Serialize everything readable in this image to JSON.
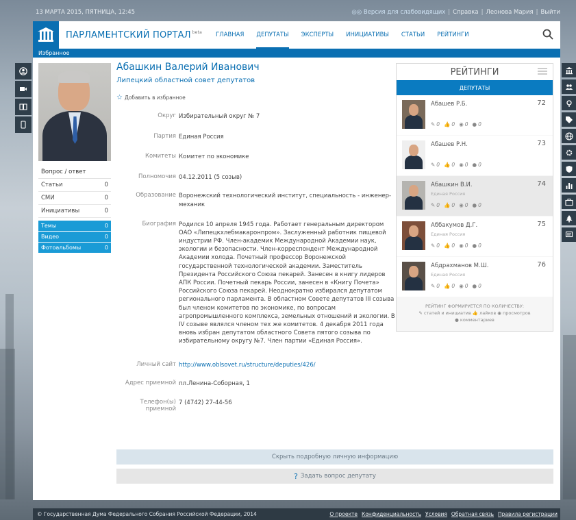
{
  "topbar": {
    "date": "13 МАРТА 2015, ПЯТНИЦА, 12:45",
    "accessible": "Версия для слабовидящих",
    "help": "Справка",
    "user": "Леонова Мария",
    "logout": "Выйти"
  },
  "header": {
    "title": "ПАРЛАМЕНТСКИЙ ПОРТАЛ",
    "beta": "beta",
    "nav": [
      "ГЛАВНАЯ",
      "ДЕПУТАТЫ",
      "ЭКСПЕРТЫ",
      "ИНИЦИАТИВЫ",
      "СТАТЬИ",
      "РЕЙТИНГИ"
    ],
    "active_nav": "ДЕПУТАТЫ"
  },
  "favorites_strip": "Избранное",
  "profile": {
    "name": "Абашкин Валерий Иванович",
    "org": "Липецкий областной совет депутатов",
    "add_fav": "Добавить в избранное",
    "qa": "Вопрос / ответ",
    "stats": [
      {
        "label": "Статьи",
        "count": "0"
      },
      {
        "label": "СМИ",
        "count": "0"
      },
      {
        "label": "Инициативы",
        "count": "0"
      }
    ],
    "blue_stats": [
      {
        "label": "Темы",
        "count": "0"
      },
      {
        "label": "Видео",
        "count": "0"
      },
      {
        "label": "Фотоальбомы",
        "count": "0"
      }
    ],
    "fields": {
      "okrug_label": "Округ",
      "okrug": "Избирательный округ № 7",
      "party_label": "Партия",
      "party": "Единая Россия",
      "committees_label": "Комитеты",
      "committees": "Комитет по экономике",
      "powers_label": "Полномочия",
      "powers": "04.12.2011 (5 созыв)",
      "education_label": "Образование",
      "education": "Воронежский технологический институт, специальность - инженер-механик",
      "bio_label": "Биография",
      "bio": "Родился 10 апреля 1945 года. Работает генеральным директором ОАО «Липецкхлебмакаронпром». Заслуженный работник пищевой индустрии РФ. Член-академик Международной Академии наук, экологии и безопасности. Член-корреспондент Международной Академии холода. Почетный профессор Воронежской государственной технологической академии. Заместитель Президента Российского Союза пекарей. Занесен в книгу лидеров АПК России. Почетный пекарь России, занесен в «Книгу Почета» Российского Союза пекарей. Неоднократно избирался депутатом регионального парламента. В областном Совете депутатов III созыва был членом комитетов по экономике, по вопросам агропромышленного комплекса, земельных отношений и экологии. В IV созыве являлся членом тех же комитетов. 4 декабря 2011 года вновь избран депутатом областного Совета пятого созыва по избирательному округу №7. Член партии «Единая Россия».",
      "site_label": "Личный сайт",
      "site": "http://www.oblsovet.ru/structure/deputies/426/",
      "address_label": "Адрес приемной",
      "address": "пл.Ленина-Соборная, 1",
      "phone_label": "Телефон(ы) приемной",
      "phone": "7 (4742) 27-44-56"
    },
    "hide_btn": "Скрыть подробную личную информацию",
    "ask_btn": "Задать вопрос депутату"
  },
  "ratings": {
    "title": "РЕЙТИНГИ",
    "tab": "ДЕПУТАТЫ",
    "items": [
      {
        "name": "Абашев Р.Б.",
        "party": "",
        "rank": "72",
        "s1": "0",
        "s2": "0",
        "s3": "0",
        "s4": "0"
      },
      {
        "name": "Абашев Р.Н.",
        "party": "",
        "rank": "73",
        "s1": "0",
        "s2": "0",
        "s3": "0",
        "s4": "0"
      },
      {
        "name": "Абашкин В.И.",
        "party": "Единая Россия",
        "rank": "74",
        "s1": "0",
        "s2": "0",
        "s3": "0",
        "s4": "0"
      },
      {
        "name": "Аббакумов Д.Г.",
        "party": "Единая Россия",
        "rank": "75",
        "s1": "0",
        "s2": "0",
        "s3": "0",
        "s4": "0"
      },
      {
        "name": "Абдрахманов М.Ш.",
        "party": "Единая Россия",
        "rank": "76",
        "s1": "0",
        "s2": "0",
        "s3": "0",
        "s4": "0"
      }
    ],
    "foot_title": "РЕЙТИНГ ФОРМИРУЕТСЯ ПО КОЛИЧЕСТВУ:",
    "foot_articles": "статей и инициатив",
    "foot_likes": "лайков",
    "foot_views": "просмотров",
    "foot_comments": "комментариев"
  },
  "footer": {
    "copyright": "© Государственная Дума Федерального Собрания Российской Федерации, 2014",
    "links": [
      "О проекте",
      "Конфиденциальность",
      "Условия",
      "Обратная связь",
      "Правила регистрации"
    ]
  },
  "colors": {
    "brand": "#0a6fb2",
    "accent": "#1a9bd6",
    "dark": "#2e3a44"
  }
}
